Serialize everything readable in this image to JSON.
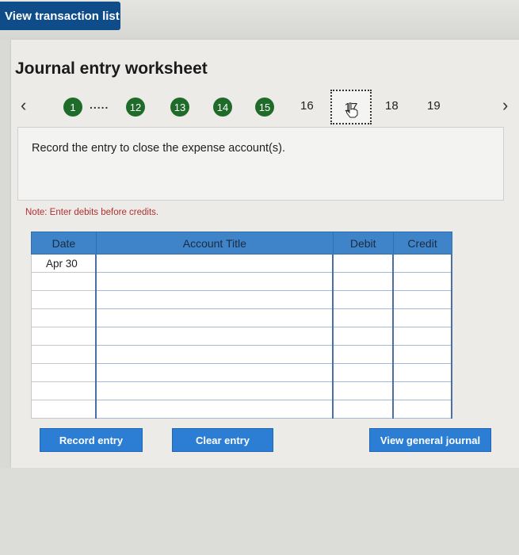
{
  "header": {
    "view_list_label": "View transaction list"
  },
  "worksheet": {
    "title": "Journal entry worksheet",
    "nav": {
      "prev_icon": "chevron-left-icon",
      "next_icon": "chevron-right-icon",
      "completed_steps": [
        "1",
        "12",
        "13",
        "14",
        "15"
      ],
      "dots": ".....",
      "upcoming_steps": [
        "16",
        "17",
        "18",
        "19"
      ],
      "current_step": "17"
    },
    "instruction": "Record the entry to close the expense account(s).",
    "note": "Note: Enter debits before credits.",
    "table": {
      "headers": {
        "date": "Date",
        "account": "Account Title",
        "debit": "Debit",
        "credit": "Credit"
      },
      "rows": [
        {
          "date": "Apr 30"
        },
        {
          "date": ""
        },
        {
          "date": ""
        },
        {
          "date": ""
        },
        {
          "date": ""
        },
        {
          "date": ""
        },
        {
          "date": ""
        },
        {
          "date": ""
        },
        {
          "date": ""
        }
      ]
    },
    "buttons": {
      "record": "Record entry",
      "clear": "Clear entry",
      "view_journal": "View general journal"
    }
  },
  "colors": {
    "brand_blue": "#0f4c8a",
    "header_blue": "#3f84c8",
    "button_blue": "#2b7ed4",
    "step_green": "#1f6b2a",
    "note_red": "#b03030"
  }
}
